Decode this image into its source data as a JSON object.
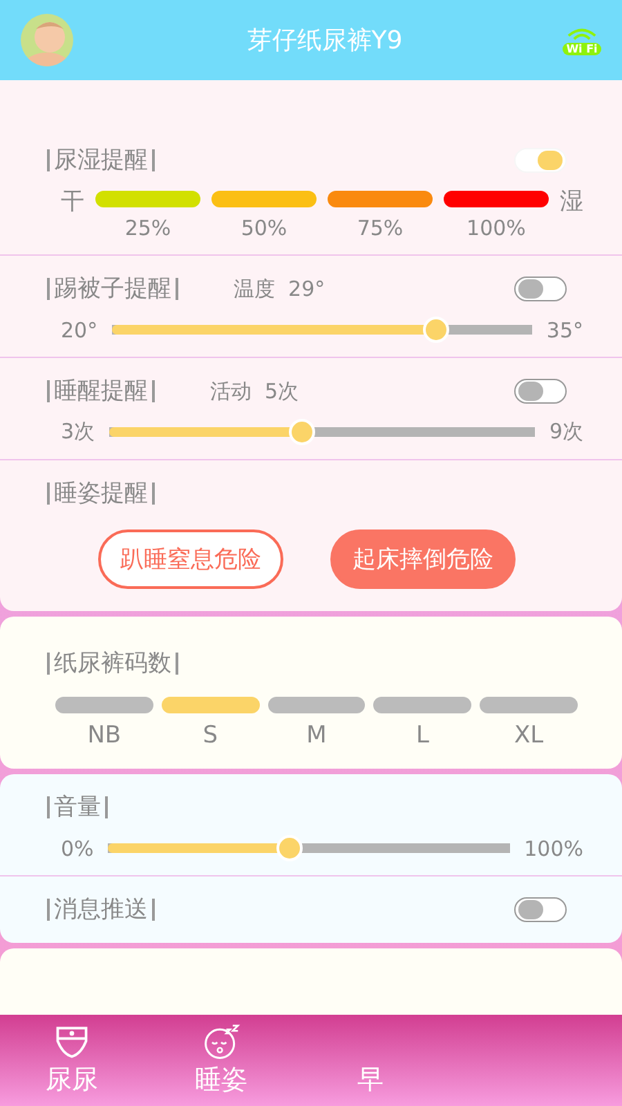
{
  "header": {
    "title": "芽仔纸尿裤Y9",
    "wifi_label": "Wi Fi"
  },
  "cards": [
    {
      "sections": [
        {
          "kind": "wetness",
          "title": "尿湿提醒",
          "on": true,
          "left": "干",
          "right": "湿",
          "bars": [
            {
              "label": "25%",
              "color": "#d2e000"
            },
            {
              "label": "50%",
              "color": "#fbbf14"
            },
            {
              "label": "75%",
              "color": "#fa8a0f"
            },
            {
              "label": "100%",
              "color": "#ff0000"
            }
          ]
        },
        {
          "kind": "slider",
          "title": "踢被子提醒",
          "reading": "温度  29°",
          "on": false,
          "min": "20°",
          "max": "35°",
          "level": 0.77
        },
        {
          "kind": "slider",
          "title": "睡醒提醒",
          "reading": "活动  5次",
          "on": false,
          "min": "3次",
          "max": "9次",
          "level": 0.45
        },
        {
          "kind": "buttons",
          "title": "睡姿提醒",
          "buttons": [
            {
              "label": "趴睡窒息危险",
              "selected": false
            },
            {
              "label": "起床摔倒危险",
              "selected": true
            }
          ]
        }
      ]
    },
    {
      "sections": [
        {
          "kind": "sizes",
          "title": "纸尿裤码数",
          "sizes": [
            {
              "label": "NB",
              "selected": false
            },
            {
              "label": "S",
              "selected": true
            },
            {
              "label": "M",
              "selected": false
            },
            {
              "label": "L",
              "selected": false
            },
            {
              "label": "XL",
              "selected": false
            }
          ]
        }
      ]
    },
    {
      "sections": [
        {
          "kind": "slider",
          "title": "音量",
          "min": "0%",
          "max": "100%",
          "level": 0.45
        },
        {
          "kind": "toggle",
          "title": "消息推送",
          "on": false
        }
      ]
    }
  ],
  "tabs": [
    {
      "label": "尿尿",
      "selected": false
    },
    {
      "label": "睡姿",
      "selected": false
    },
    {
      "label": "早",
      "selected": false
    }
  ]
}
